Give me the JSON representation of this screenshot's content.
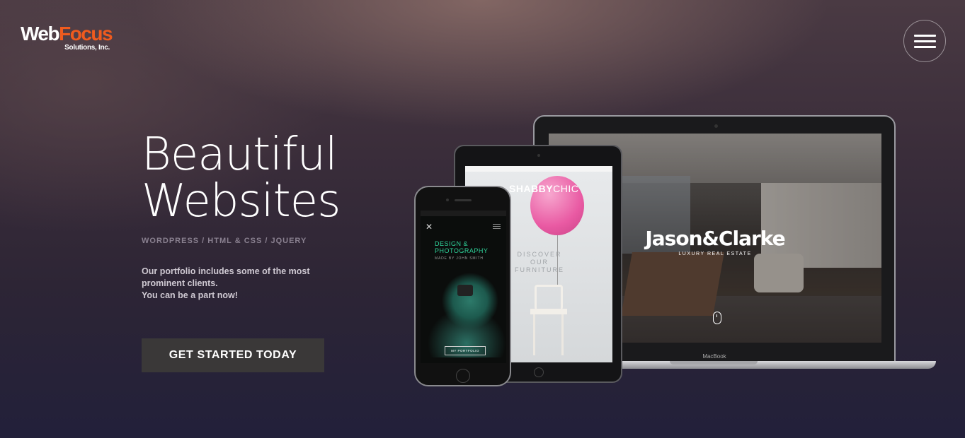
{
  "header": {
    "logo": {
      "word1": "Web",
      "word2": "Focus",
      "tagline": "Solutions, Inc."
    },
    "menu_icon": "hamburger-menu-icon"
  },
  "hero": {
    "title_line1": "Beautiful",
    "title_line2": "Websites",
    "subtitle": "WORDPRESS / HTML & CSS / JQUERY",
    "desc_line1": "Our portfolio includes some of the most prominent clients.",
    "desc_line2": "You can be a part now!",
    "cta": "GET STARTED TODAY"
  },
  "devices": {
    "laptop": {
      "brand": "Jason&Clarke",
      "tagline": "LUXURY REAL ESTATE",
      "label": "MacBook"
    },
    "tablet": {
      "brand_a": "SHABBY",
      "brand_b": "CHIC",
      "text": "DISCOVER OUR FURNITURE"
    },
    "phone": {
      "title_line1": "DESIGN &",
      "title_line2": "PHOTOGRAPHY",
      "made_by": "MADE BY JOHN SMITH",
      "button": "MY PORTFOLIO"
    }
  },
  "colors": {
    "accent": "#ef5b1e",
    "cta_bg": "#3a3838",
    "phone_accent": "#2fd39a",
    "balloon": "#e95aa3"
  }
}
